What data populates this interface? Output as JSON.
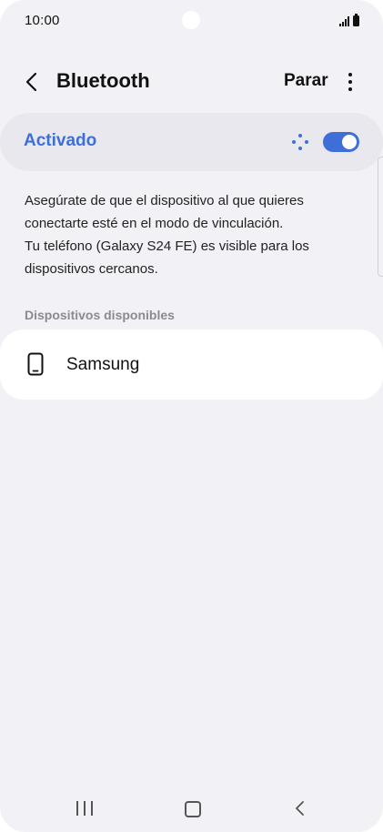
{
  "status_bar": {
    "time": "10:00",
    "icons": [
      "signal-icon",
      "battery-icon"
    ]
  },
  "header": {
    "back_icon": "chevron-left-icon",
    "title": "Bluetooth",
    "stop_label": "Parar",
    "more_icon": "more-vertical-icon"
  },
  "bluetooth_toggle": {
    "label": "Activado",
    "state": "on",
    "scanning_icon": "scanning-dots-icon",
    "accent_color": "#3e6fd8"
  },
  "description": {
    "lines": [
      "Asegúrate de que el dispositivo al que quieres",
      "conectarte esté en el modo de vinculación.",
      "Tu teléfono (Galaxy S24 FE) es visible para los",
      "dispositivos cercanos."
    ]
  },
  "available_devices": {
    "header": "Dispositivos disponibles",
    "items": [
      {
        "name": "Samsung",
        "icon": "phone-icon"
      }
    ]
  },
  "nav_bar": {
    "icons": [
      "recent-apps-icon",
      "home-icon",
      "back-icon"
    ]
  }
}
